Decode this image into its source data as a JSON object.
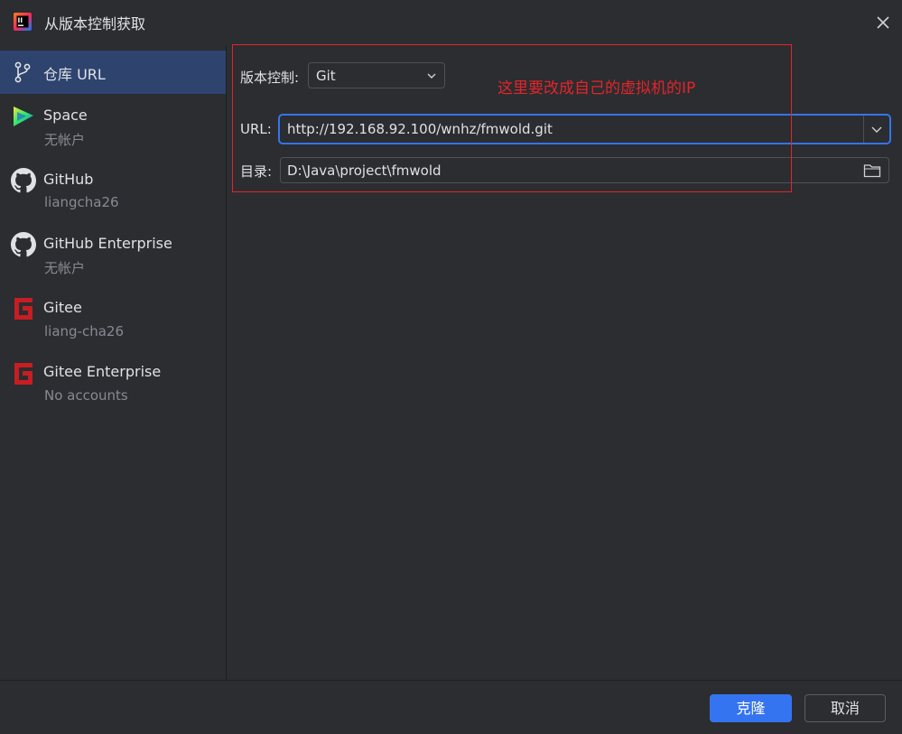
{
  "window": {
    "title": "从版本控制获取"
  },
  "sidebar": {
    "items": [
      {
        "label": "仓库 URL",
        "sub": "",
        "icon": "git-branch-icon",
        "selected": true
      },
      {
        "label": "Space",
        "sub": "无帐户",
        "icon": "space-icon"
      },
      {
        "label": "GitHub",
        "sub": "liangcha26",
        "icon": "github-icon"
      },
      {
        "label": "GitHub Enterprise",
        "sub": "无帐户",
        "icon": "github-icon"
      },
      {
        "label": "Gitee",
        "sub": "liang-cha26",
        "icon": "gitee-icon"
      },
      {
        "label": "Gitee Enterprise",
        "sub": "No accounts",
        "icon": "gitee-icon"
      }
    ]
  },
  "form": {
    "vcs_label": "版本控制:",
    "vcs_value": "Git",
    "url_label": "URL:",
    "url_value": "http://192.168.92.100/wnhz/fmwold.git",
    "dir_label": "目录:",
    "dir_value": "D:\\Java\\project\\fmwold"
  },
  "annotation": {
    "text": "这里要改成自己的虚拟机的IP",
    "color": "#e3242b"
  },
  "footer": {
    "clone_label": "克隆",
    "cancel_label": "取消"
  },
  "colors": {
    "background": "#2b2d30",
    "selection": "#2e436e",
    "accent": "#3574f0",
    "muted_text": "#868a91"
  }
}
